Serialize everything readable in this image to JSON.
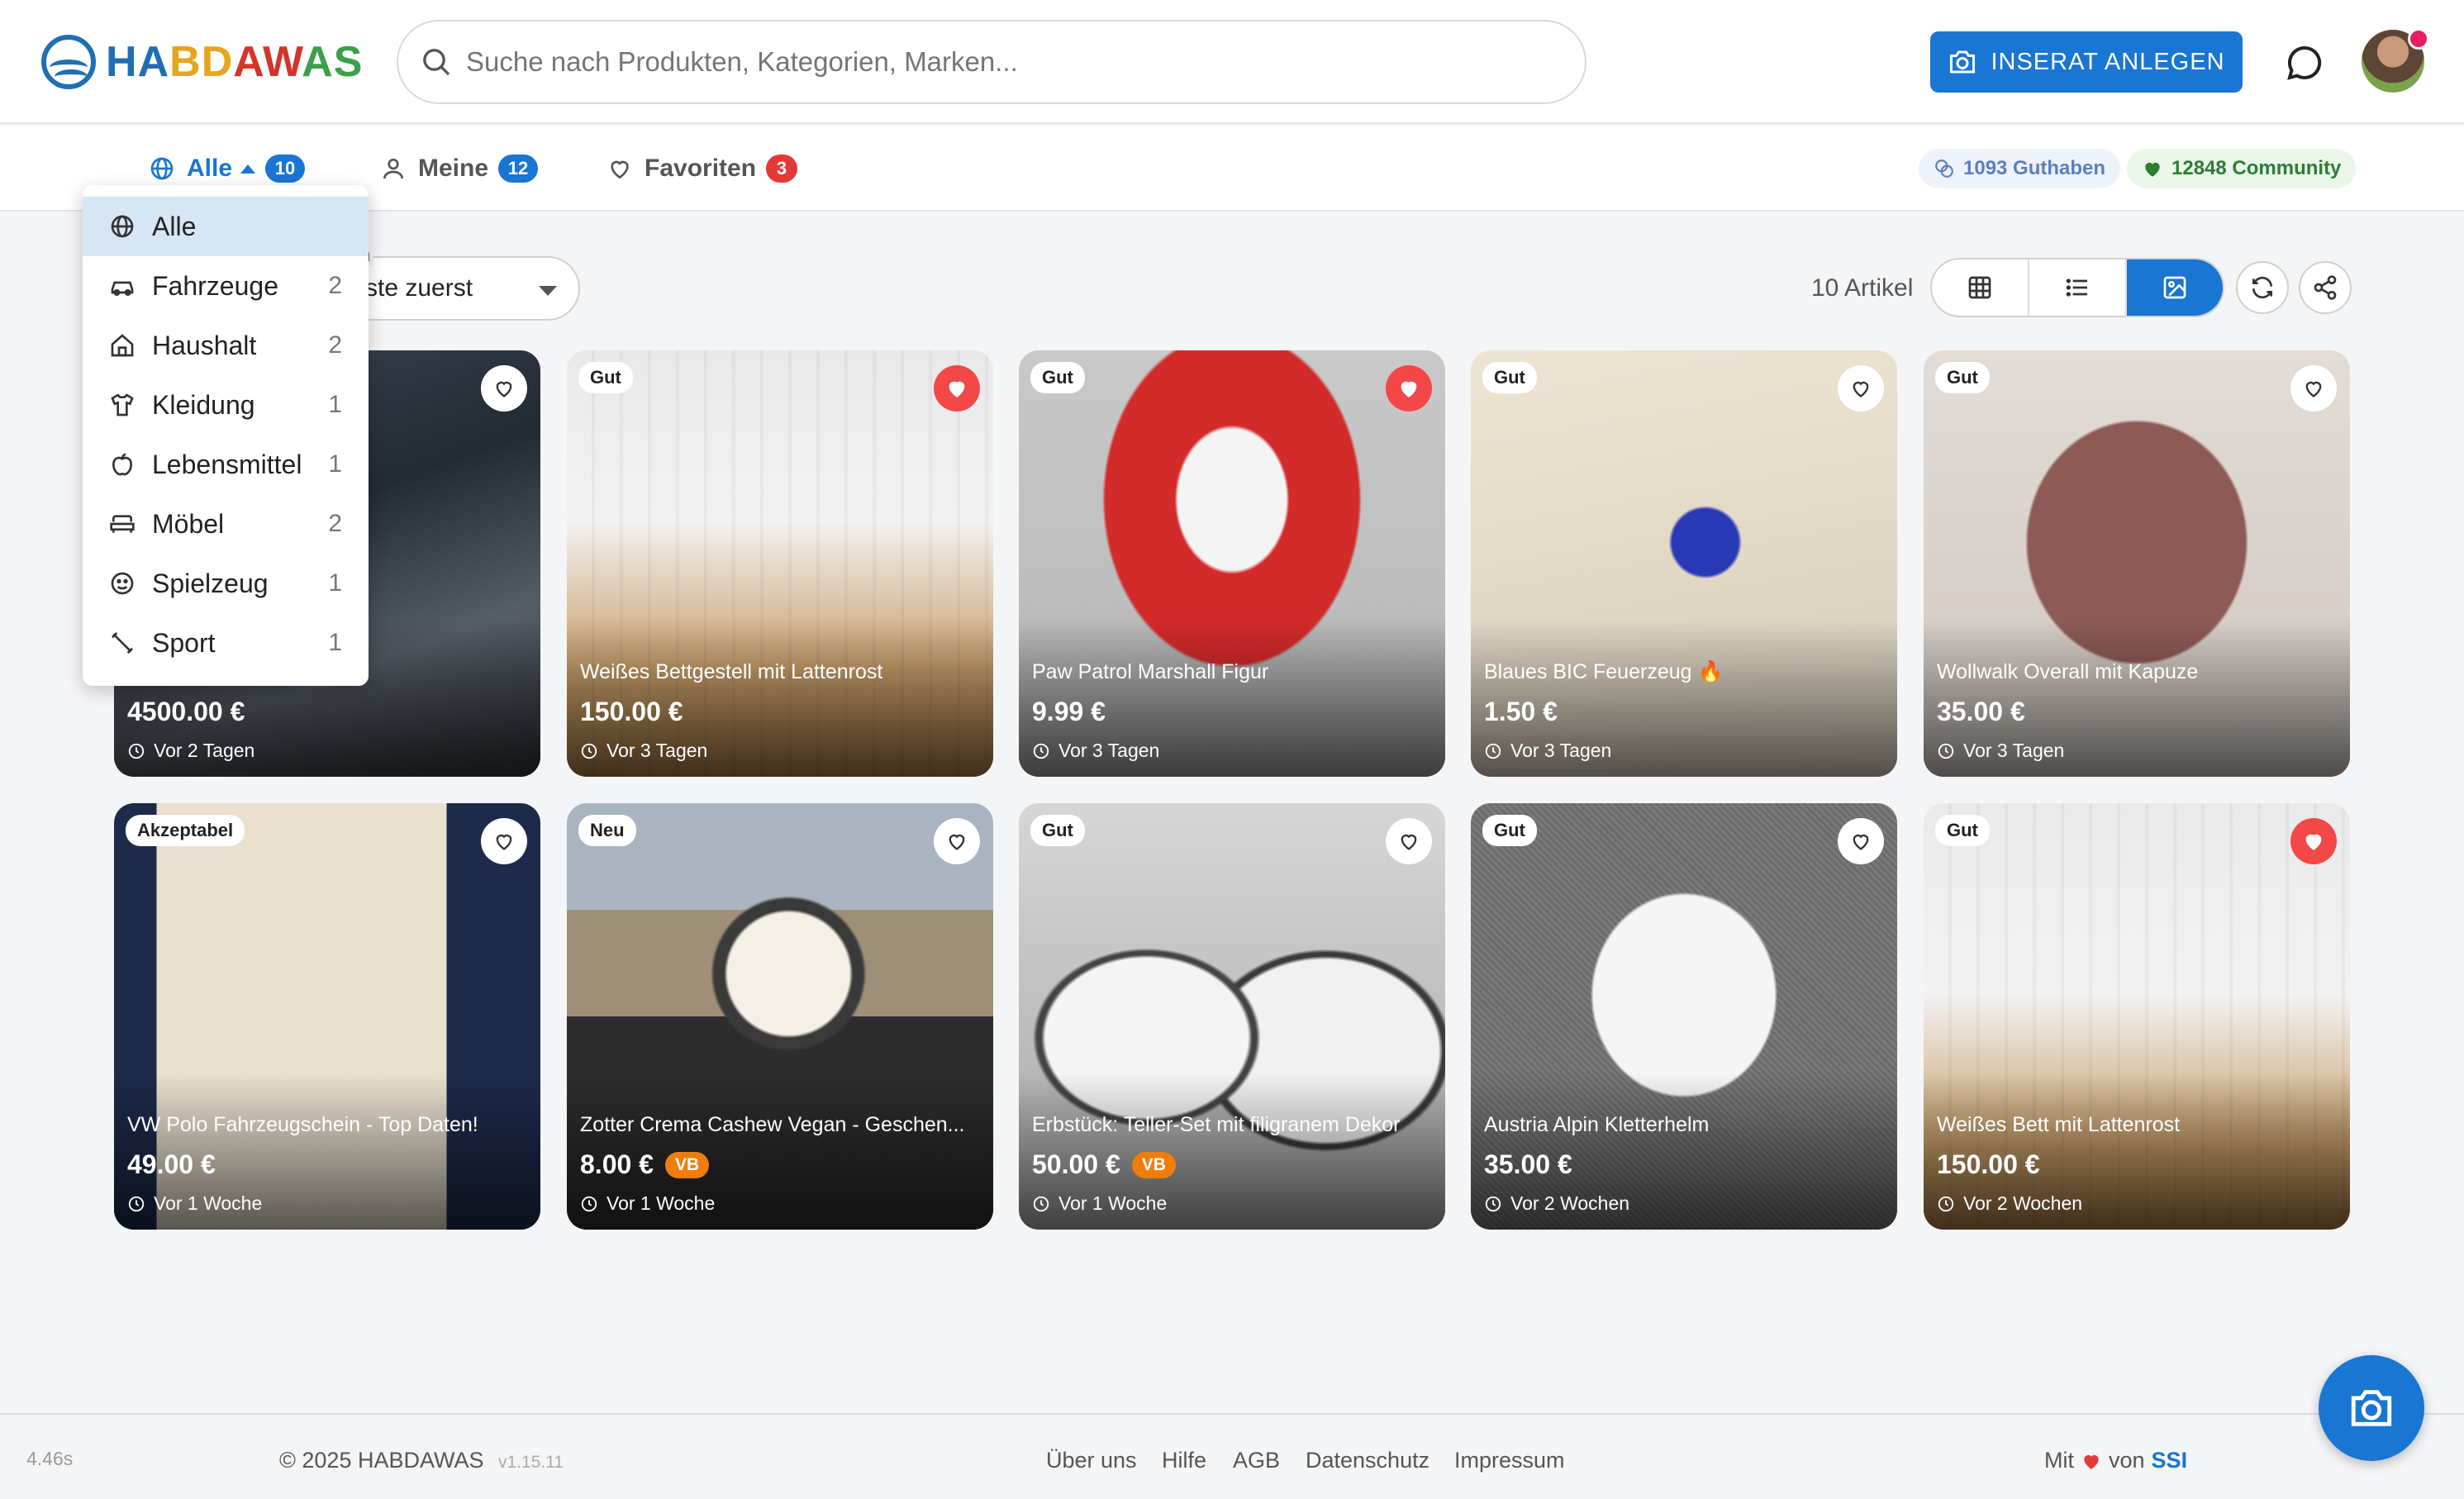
{
  "header": {
    "logo_text": "HABDAWAS",
    "search_placeholder": "Suche nach Produkten, Kategorien, Marken...",
    "create_button": "INSERAT ANLEGEN"
  },
  "tabs": [
    {
      "label": "Alle",
      "count": "10"
    },
    {
      "label": "Meine",
      "count": "12"
    },
    {
      "label": "Favoriten",
      "count": "3"
    }
  ],
  "stats": {
    "guthaben": "1093 Guthaben",
    "community": "12848 Community"
  },
  "toolbar": {
    "sort_label": "en",
    "sort_value": "ste zuerst",
    "article_count": "10 Artikel"
  },
  "dropdown": [
    {
      "label": "Alle",
      "count": "",
      "icon": "globe-icon"
    },
    {
      "label": "Fahrzeuge",
      "count": "2",
      "icon": "car-icon"
    },
    {
      "label": "Haushalt",
      "count": "2",
      "icon": "home-icon"
    },
    {
      "label": "Kleidung",
      "count": "1",
      "icon": "shirt-icon"
    },
    {
      "label": "Lebensmittel",
      "count": "1",
      "icon": "apple-icon"
    },
    {
      "label": "Möbel",
      "count": "2",
      "icon": "sofa-icon"
    },
    {
      "label": "Spielzeug",
      "count": "1",
      "icon": "toy-icon"
    },
    {
      "label": "Sport",
      "count": "1",
      "icon": "sport-icon"
    }
  ],
  "items": [
    {
      "title": "ck mit Geschi...",
      "price": "4500.00 €",
      "time": "Vor 2 Tagen",
      "condition": "",
      "vb": "",
      "favorite": false
    },
    {
      "title": "Weißes Bettgestell mit Lattenrost",
      "price": "150.00 €",
      "time": "Vor 3 Tagen",
      "condition": "Gut",
      "vb": "",
      "favorite": true
    },
    {
      "title": "Paw Patrol Marshall Figur",
      "price": "9.99 €",
      "time": "Vor 3 Tagen",
      "condition": "Gut",
      "vb": "",
      "favorite": true
    },
    {
      "title": "Blaues BIC Feuerzeug 🔥",
      "price": "1.50 €",
      "time": "Vor 3 Tagen",
      "condition": "Gut",
      "vb": "",
      "favorite": false
    },
    {
      "title": "Wollwalk Overall mit Kapuze",
      "price": "35.00 €",
      "time": "Vor 3 Tagen",
      "condition": "Gut",
      "vb": "",
      "favorite": false
    },
    {
      "title": "VW Polo Fahrzeugschein - Top Daten!",
      "price": "49.00 €",
      "time": "Vor 1 Woche",
      "condition": "Akzeptabel",
      "vb": "",
      "favorite": false
    },
    {
      "title": "Zotter Crema Cashew Vegan - Geschen...",
      "price": "8.00 €",
      "time": "Vor 1 Woche",
      "condition": "Neu",
      "vb": "VB",
      "favorite": false
    },
    {
      "title": "Erbstück: Teller-Set mit filigranem Dekor",
      "price": "50.00 €",
      "time": "Vor 1 Woche",
      "condition": "Gut",
      "vb": "VB",
      "favorite": false
    },
    {
      "title": "Austria Alpin Kletterhelm",
      "price": "35.00 €",
      "time": "Vor 2 Wochen",
      "condition": "Gut",
      "vb": "",
      "favorite": false
    },
    {
      "title": "Weißes Bett mit Lattenrost",
      "price": "150.00 €",
      "time": "Vor 2 Wochen",
      "condition": "Gut",
      "vb": "",
      "favorite": true
    }
  ],
  "footer": {
    "load_time": "4.46s",
    "copyright": "© 2025 HABDAWAS",
    "version": "v1.15.11",
    "links": [
      "Über uns",
      "Hilfe",
      "AGB",
      "Datenschutz",
      "Impressum"
    ],
    "made_with": "Mit",
    "made_by_prefix": "von",
    "made_by": "SSI"
  },
  "colors": {
    "primary": "#1976d2",
    "favorite_red": "#f44848",
    "vb_orange": "#ef7d0b"
  }
}
